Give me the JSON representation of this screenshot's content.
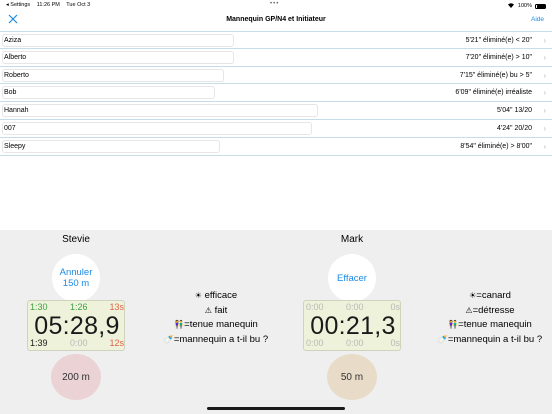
{
  "status_bar": {
    "back_app": "◂ Settings",
    "time": "11:26 PM",
    "date": "Tue Oct 3",
    "battery_percent": "100%"
  },
  "nav": {
    "title": "Mannequin GP/N4 et Initiateur",
    "help": "Aide",
    "close_icon": "close-icon"
  },
  "rows": [
    {
      "name": "Aziza",
      "result": "5'21\" éliminé(e) < 20\"",
      "bar_fraction": 0.42
    },
    {
      "name": "Alberto",
      "result": "7'20\" éliminé(e) > 10\"",
      "bar_fraction": 0.42
    },
    {
      "name": "Roberto",
      "result": "7'15\" éliminé(e) bu > 5\"",
      "bar_fraction": 0.4
    },
    {
      "name": "Bob",
      "result": "6'09\" éliminé(e) irréaliste",
      "bar_fraction": 0.39
    },
    {
      "name": "Hannah",
      "result": "5'04\" 13/20",
      "bar_fraction": 0.57
    },
    {
      "name": "007",
      "result": "4'24\" 20/20",
      "bar_fraction": 0.56
    },
    {
      "name": "Sleepy",
      "result": "8'54\" éliminé(e) > 8'00\"",
      "bar_fraction": 0.39
    }
  ],
  "left_player": {
    "name": "Stevie",
    "action_line1": "Annuler",
    "action_line2": "150 m",
    "distance": "200 m",
    "timer": {
      "top_a": "1:30",
      "top_b": "1:26",
      "top_c": "13s",
      "main": "05:28,9",
      "bottom_a": "1:39",
      "bottom_b": "0:00",
      "bottom_c": "12s"
    },
    "legend": {
      "line1": "efficace",
      "line2": "fait",
      "line3": "=tenue manequin",
      "line4": "=mannequin a t-il bu ?"
    }
  },
  "right_player": {
    "name": "Mark",
    "action_line1": "Effacer",
    "distance": "50 m",
    "timer": {
      "top_a": "0:00",
      "top_b": "0:00",
      "top_c": "0s",
      "main": "00:21,3",
      "bottom_a": "0:00",
      "bottom_b": "0:00",
      "bottom_c": "0s"
    },
    "legend": {
      "line1": "=canard",
      "line2": "=détresse",
      "line3": "=tenue manequin",
      "line4": "=mannequin a t-il bu ?"
    }
  },
  "icons": {
    "sun": "☀",
    "warning": "⚠",
    "people": "👫",
    "bottle": "🍼"
  },
  "colors": {
    "accent": "#1a8ae6",
    "timer_bg": "#eef2da",
    "green": "#3ea043",
    "red": "#e0624a",
    "dist_left": "#ebd2d4",
    "dist_right": "#e8dcc8"
  }
}
